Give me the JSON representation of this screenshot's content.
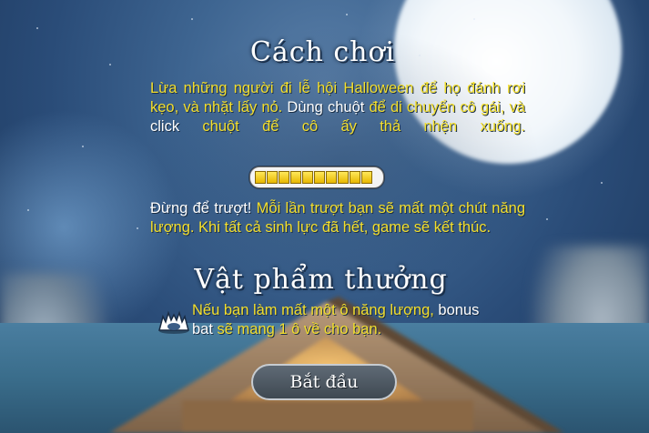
{
  "how_to_play": {
    "title": "Cách chơi",
    "p1": {
      "s1": "Lừa những người đi lễ hội Halloween để họ đánh rơi kẹo, và nhặt lấy nó.",
      "s2": " Dùng ",
      "s3": "chuột",
      "s4": " để di chuyển cô gái, và ",
      "s5": "click",
      "s6": " chuột để cô ấy thả nhện xuống."
    },
    "energy_level": 1.0,
    "energy_segments": 10,
    "p2": {
      "s1": "Đừng để trượt!",
      "s2": " Mỗi lần trượt bạn sẽ mất một chút năng lượng. Khi tất cả sinh lực đã hết, game sẽ kết thúc."
    }
  },
  "bonus": {
    "title": "Vật phẩm thưởng",
    "icon": "bat-icon",
    "s1": "Nếu bạn làm mất một ô năng lượng, ",
    "s2": "bonus bat",
    "s3": " sẽ mang 1 ô về cho bạn."
  },
  "start_button": {
    "label": "Bắt đầu"
  },
  "colors": {
    "highlight": "#f4df2c",
    "text": "#ffffff",
    "bar_fill": "#ffd400"
  }
}
